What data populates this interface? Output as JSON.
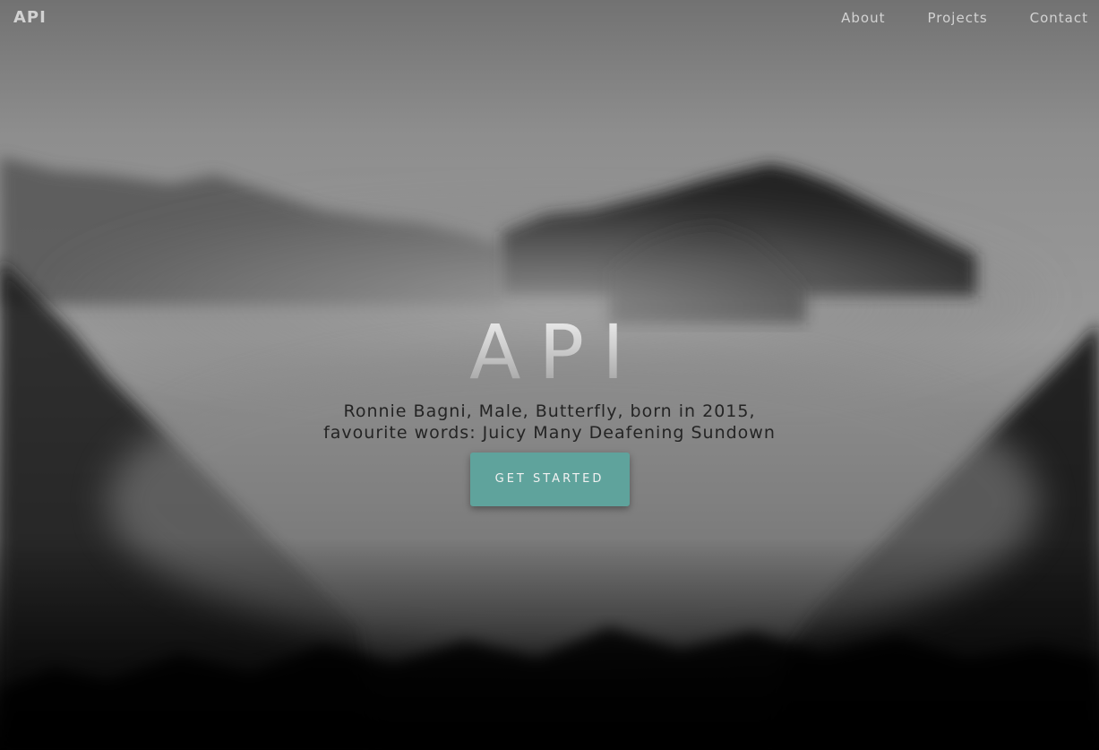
{
  "nav": {
    "brand": "API",
    "links": [
      {
        "label": "About"
      },
      {
        "label": "Projects"
      },
      {
        "label": "Contact"
      }
    ]
  },
  "hero": {
    "title": "API",
    "subtitle_line1": "Ronnie Bagni, Male, Butterfly, born in 2015,",
    "subtitle_line2": "favourite words: Juicy Many Deafening Sundown",
    "cta_label": "GET STARTED"
  },
  "colors": {
    "accent": "#5fa39c",
    "nav_text": "#d3d3d3",
    "subtitle_text": "#242424"
  }
}
